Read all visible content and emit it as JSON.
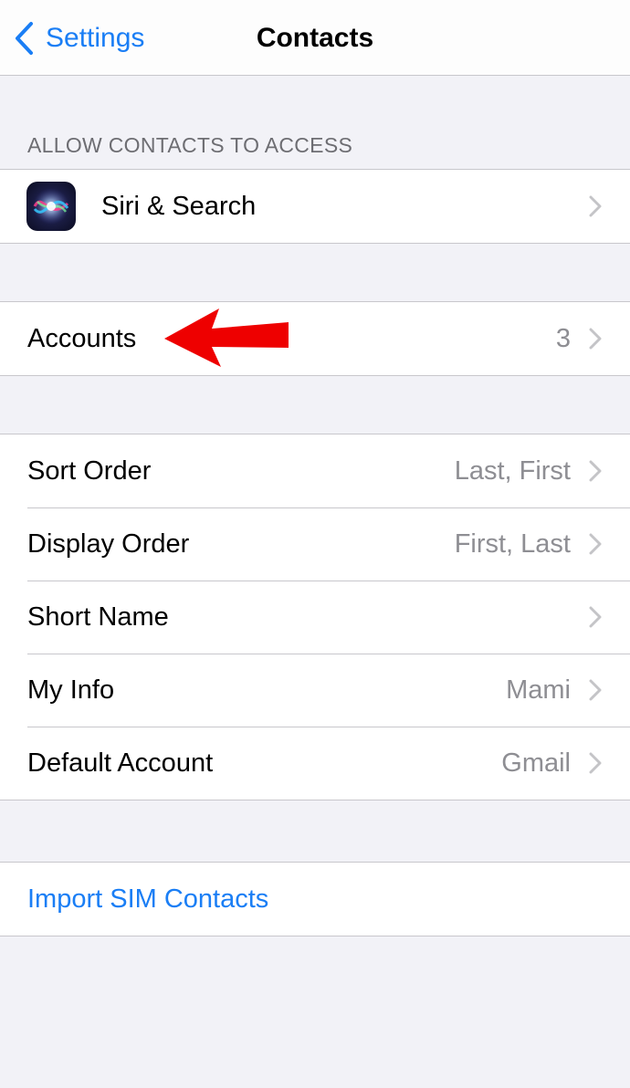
{
  "nav": {
    "back_label": "Settings",
    "title": "Contacts"
  },
  "section_access": {
    "header": "ALLOW CONTACTS TO ACCESS",
    "items": [
      {
        "label": "Siri & Search",
        "icon": "siri-icon"
      }
    ]
  },
  "accounts": {
    "label": "Accounts",
    "value": "3"
  },
  "settings": {
    "items": [
      {
        "label": "Sort Order",
        "value": "Last, First"
      },
      {
        "label": "Display Order",
        "value": "First, Last"
      },
      {
        "label": "Short Name",
        "value": ""
      },
      {
        "label": "My Info",
        "value": "Mami"
      },
      {
        "label": "Default Account",
        "value": "Gmail"
      }
    ]
  },
  "import": {
    "label": "Import SIM Contacts"
  },
  "colors": {
    "accent": "#1a7ef5",
    "background": "#f2f2f7",
    "secondary_text": "#8e8e93",
    "annotation_arrow": "#ee0000"
  }
}
